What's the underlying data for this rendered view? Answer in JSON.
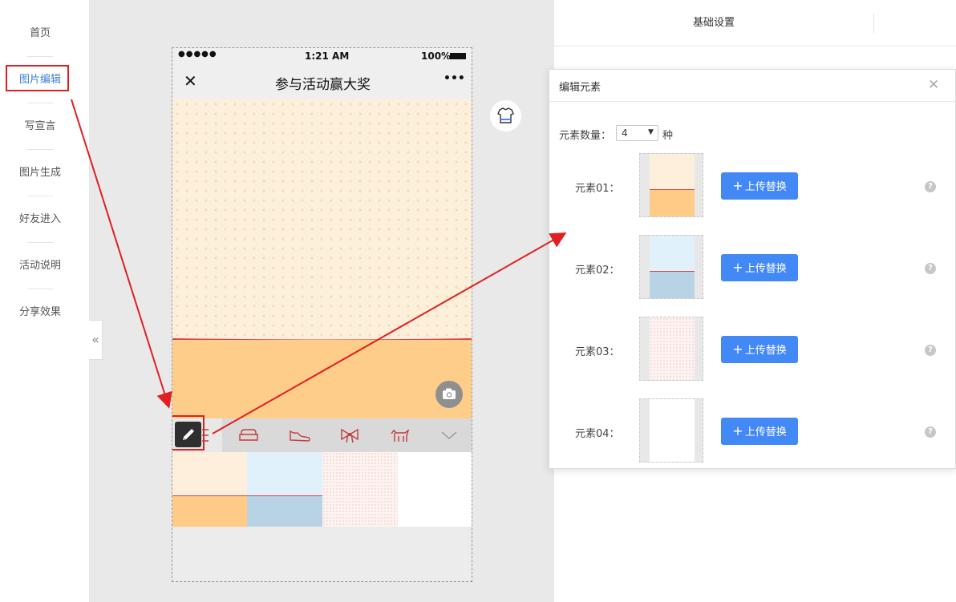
{
  "sidebar": {
    "items": [
      {
        "label": "首页"
      },
      {
        "label": "图片编辑"
      },
      {
        "label": "写宣言"
      },
      {
        "label": "图片生成"
      },
      {
        "label": "好友进入"
      },
      {
        "label": "活动说明"
      },
      {
        "label": "分享效果"
      }
    ],
    "collapse_glyph": "«"
  },
  "phone": {
    "status": {
      "signal": "●●●●●",
      "time": "1:21 AM",
      "battery": "100%"
    },
    "nav": {
      "close_glyph": "✕",
      "title": "参与活动赢大奖",
      "more_glyph": "•••"
    },
    "toolbar_icons": [
      "pencil-icon",
      "sofa-icon",
      "shoe-icon",
      "bow-icon",
      "dog-icon",
      "chevron-down-icon"
    ],
    "palette_swatches": [
      "element-01",
      "element-02",
      "element-03",
      "element-04"
    ]
  },
  "right_panel": {
    "tab": "基础设置"
  },
  "modal": {
    "title": "编辑元素",
    "close_glyph": "✕",
    "count_label": "元素数量：",
    "count_value": "4",
    "count_unit": "种",
    "elements": [
      {
        "label": "元素01：",
        "button": "上传替换",
        "help": "?"
      },
      {
        "label": "元素02：",
        "button": "上传替换",
        "help": "?"
      },
      {
        "label": "元素03：",
        "button": "上传替换",
        "help": "?"
      },
      {
        "label": "元素04：",
        "button": "上传替换",
        "help": "?"
      }
    ]
  },
  "colors": {
    "accent": "#4389f6",
    "annotation_red": "#e02020",
    "cream": "#fdf0db",
    "orange": "#ffcd8a",
    "light_blue": "#e1f1fc",
    "steel_blue": "#b8d3e6"
  }
}
